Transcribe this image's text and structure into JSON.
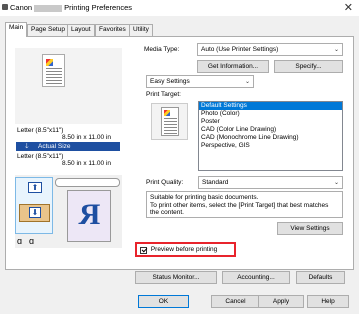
{
  "window": {
    "title_prefix": "Canon",
    "title_suffix": "Printing Preferences",
    "close_glyph": "✕"
  },
  "tabs": [
    {
      "label": "Main",
      "active": true
    },
    {
      "label": "Page Setup",
      "active": false
    },
    {
      "label": "Layout",
      "active": false
    },
    {
      "label": "Favorites",
      "active": false
    },
    {
      "label": "Utility",
      "active": false
    }
  ],
  "preview": {
    "paper_label": "Letter (8.5\"x11\")",
    "paper_size": "8.50 in x 11.00 in",
    "actual_size_label": "Actual Size",
    "output_label": "Letter (8.5\"x11\")",
    "output_size": "8.50 in x 11.00 in"
  },
  "media_type": {
    "label": "Media Type:",
    "value": "Auto (Use Printer Settings)"
  },
  "buttons": {
    "get_information": "Get Information...",
    "specify": "Specify...",
    "view_settings": "View Settings",
    "status_monitor": "Status Monitor...",
    "accounting": "Accounting...",
    "defaults": "Defaults",
    "ok": "OK",
    "cancel": "Cancel",
    "apply": "Apply",
    "help": "Help"
  },
  "settings_mode": {
    "value": "Easy Settings"
  },
  "print_target": {
    "label": "Print Target:",
    "items": [
      "Default Settings",
      "Photo (Color)",
      "Poster",
      "CAD (Color Line Drawing)",
      "CAD (Monochrome Line Drawing)",
      "Perspective, GIS"
    ],
    "selected_index": 0
  },
  "print_quality": {
    "label": "Print Quality:",
    "value": "Standard"
  },
  "description": "Suitable for printing basic documents.\nTo print other items, select the [Print Target] that best matches the content.",
  "preview_before_printing": {
    "label": "Preview before printing",
    "checked": true
  },
  "colors": {
    "accent": "#0078d7",
    "highlight_border": "#e8242c",
    "selected_text": "#ffffff"
  }
}
